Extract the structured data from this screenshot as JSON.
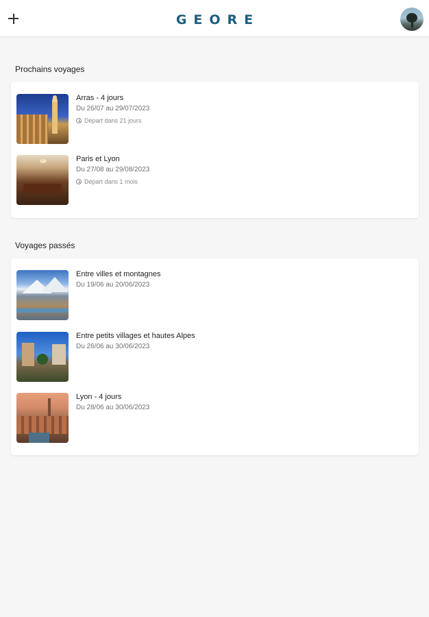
{
  "header": {
    "add_icon": "plus-icon",
    "logo": "GEORE",
    "avatar_icon": "avatar"
  },
  "upcoming": {
    "title": "Prochains voyages",
    "trips": [
      {
        "title": "Arras - 4 jours",
        "dates": "Du 26/07 au 29/07/2023",
        "status": "Départ dans 21 jours"
      },
      {
        "title": "Paris et Lyon",
        "dates": "Du 27/08 au 29/08/2023",
        "status": "Départ dans 1 mois"
      }
    ]
  },
  "past": {
    "title": "Voyages passés",
    "trips": [
      {
        "title": "Entre villes et montagnes",
        "dates": "Du 19/06 au 20/06/2023"
      },
      {
        "title": "Entre petits villages et hautes Alpes",
        "dates": "Du 26/06 au 30/06/2023"
      },
      {
        "title": "Lyon - 4 jours",
        "dates": "Du 28/06 au 30/06/2023"
      }
    ]
  },
  "colors": {
    "brand": "#1d5e80",
    "background": "#f6f6f6",
    "card": "#ffffff"
  }
}
